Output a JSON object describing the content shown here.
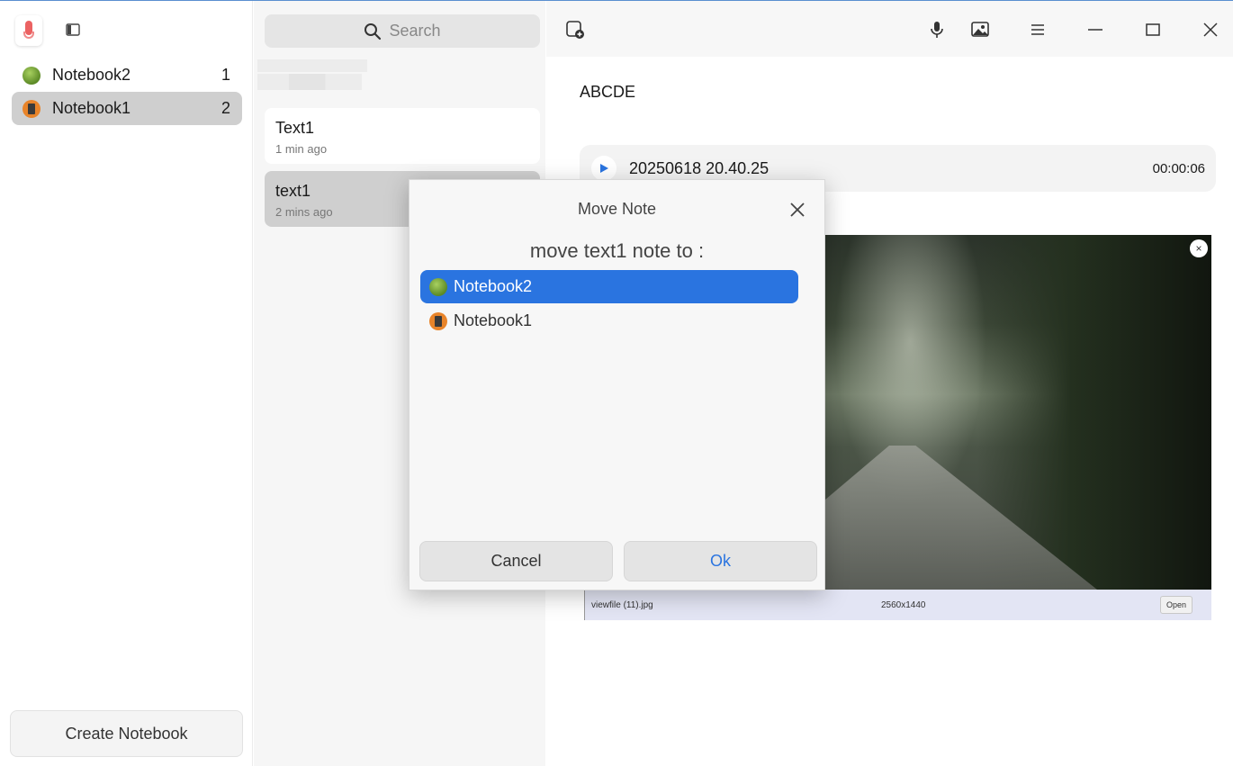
{
  "sidebar": {
    "notebooks": [
      {
        "label": "Notebook2",
        "count": "1",
        "icon": "green-globe-icon"
      },
      {
        "label": "Notebook1",
        "count": "2",
        "icon": "orange-notebook-icon"
      }
    ],
    "create_label": "Create Notebook"
  },
  "search": {
    "placeholder": "Search"
  },
  "notes": [
    {
      "title": "Text1",
      "time": "1 min ago"
    },
    {
      "title": "text1",
      "time": "2 mins ago"
    }
  ],
  "editor": {
    "text": "ABCDE",
    "audio": {
      "name": "20250618 20.40.25",
      "duration": "00:00:06"
    },
    "image": {
      "filename": "viewfile (11).jpg",
      "dimensions": "2560x1440",
      "open_label": "Open",
      "close_glyph": "×"
    }
  },
  "dialog": {
    "title": "Move Note",
    "message": "move text1 note to :",
    "options": [
      {
        "label": "Notebook2",
        "selected": true
      },
      {
        "label": "Notebook1",
        "selected": false
      }
    ],
    "cancel_label": "Cancel",
    "ok_label": "Ok"
  },
  "colors": {
    "accent": "#2a74e0",
    "selected_row": "#cfcfcf"
  }
}
